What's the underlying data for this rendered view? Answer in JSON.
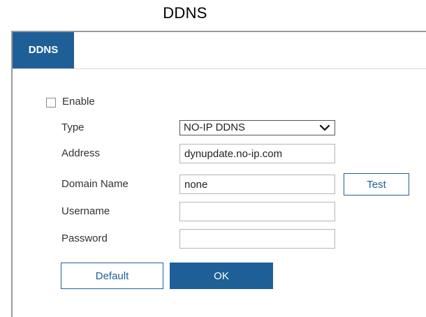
{
  "page": {
    "heading": "DDNS"
  },
  "tabs": [
    {
      "label": "DDNS",
      "active": true
    }
  ],
  "form": {
    "enable": {
      "label": "Enable",
      "checked": false
    },
    "type": {
      "label": "Type",
      "value": "NO-IP DDNS"
    },
    "address": {
      "label": "Address",
      "value": "dynupdate.no-ip.com"
    },
    "domain_name": {
      "label": "Domain Name",
      "value": "none"
    },
    "username": {
      "label": "Username",
      "value": ""
    },
    "password": {
      "label": "Password",
      "value": ""
    }
  },
  "buttons": {
    "test": "Test",
    "default": "Default",
    "ok": "OK"
  },
  "colors": {
    "accent": "#1f5f98",
    "border": "#9a9a9a"
  },
  "icons": {
    "type_dropdown": "chevron-down-icon"
  }
}
